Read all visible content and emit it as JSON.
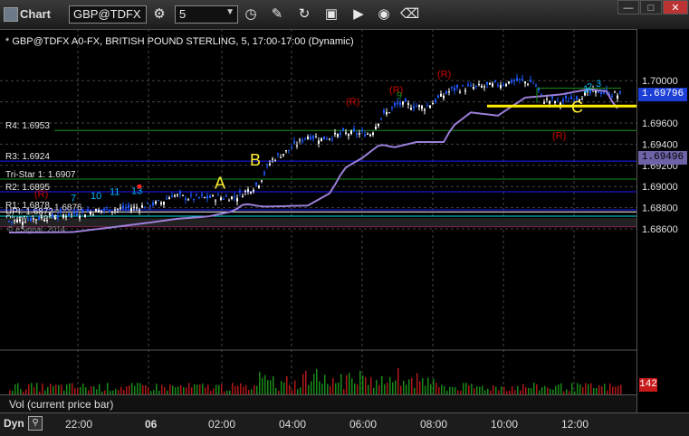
{
  "titlebar": {
    "title": "Chart",
    "symbol": "GBP@TDFX",
    "interval": "5",
    "icons": [
      "gear-icon",
      "clock-icon",
      "pencil-icon",
      "refresh-icon",
      "trade-icon",
      "play-icon",
      "record-icon",
      "eraser-icon"
    ],
    "window_buttons": [
      "minimize-icon",
      "restore-icon",
      "close-icon"
    ]
  },
  "chart": {
    "header": "* GBP@TDFX A0-FX, BRITISH POUND STERLING, 5, 17:00-17:00 (Dynamic)",
    "price_axis_ticks": [
      "1.70000",
      "1.69600",
      "1.69400",
      "1.69200",
      "1.69000",
      "1.68800",
      "1.68600"
    ],
    "price_tag_current": "1.69796",
    "price_tag_ma": "1.69496",
    "vol_tag": "142",
    "levels": [
      {
        "label": "R4: 1.6953",
        "value": 1.6953,
        "color": "#1a8f1a"
      },
      {
        "label": "R3: 1.6924",
        "value": 1.6924,
        "color": "#1a1aff"
      },
      {
        "label": "Tri-Star 1: 1.6907",
        "value": 1.6907,
        "color": "#1a8f1a"
      },
      {
        "label": "R2: 1.6895",
        "value": 1.6895,
        "color": "#1a1aff"
      },
      {
        "label": "R1: 1.6878",
        "value": 1.6878,
        "color": "#1a1aff"
      },
      {
        "label": "1.6876",
        "value": 1.6876,
        "color": "#ffffff"
      },
      {
        "label": "UPI: 1.6872",
        "value": 1.6872,
        "color": "#00e5e5"
      },
      {
        "label": "Pivot: 1.6865",
        "value": 1.6865,
        "color": "#ffffff"
      },
      {
        "label": "VAL: 1.6862",
        "value": 1.6862,
        "color": "#ff2aa0"
      }
    ],
    "copyright": "© eSignal, 2014",
    "annotations": {
      "a": "A",
      "b": "B",
      "c": "C"
    },
    "markers": [
      {
        "text": "(R)",
        "color": "#cc0000"
      },
      {
        "text": "(R)",
        "color": "#cc0000"
      },
      {
        "text": "(R)",
        "color": "#cc0000"
      },
      {
        "text": "(R)",
        "color": "#cc0000"
      },
      {
        "text": "(R)",
        "color": "#cc0000"
      },
      {
        "text": "9",
        "color": "#1a8f1a"
      },
      {
        "text": "13",
        "color": "#00b7ff"
      },
      {
        "text": "11",
        "color": "#00b7ff"
      },
      {
        "text": "10",
        "color": "#00b7ff"
      },
      {
        "text": "7",
        "color": "#00b7ff"
      },
      {
        "text": "2",
        "color": "#00b7ff"
      },
      {
        "text": "3",
        "color": "#00b7ff"
      },
      {
        "text": "1",
        "color": "#00b7ff"
      }
    ]
  },
  "volume": {
    "title": "Vol (current price bar)"
  },
  "time_axis": {
    "mode": "Dyn",
    "labels": [
      "22:00",
      "06",
      "02:00",
      "04:00",
      "06:00",
      "08:00",
      "10:00",
      "12:00"
    ]
  },
  "colors": {
    "bar_up": "#ffffff",
    "bar_down": "#1e5bff",
    "ma": "#9b7fd8",
    "yellow_line": "#ffee00",
    "annotation": "#ffee33"
  }
}
